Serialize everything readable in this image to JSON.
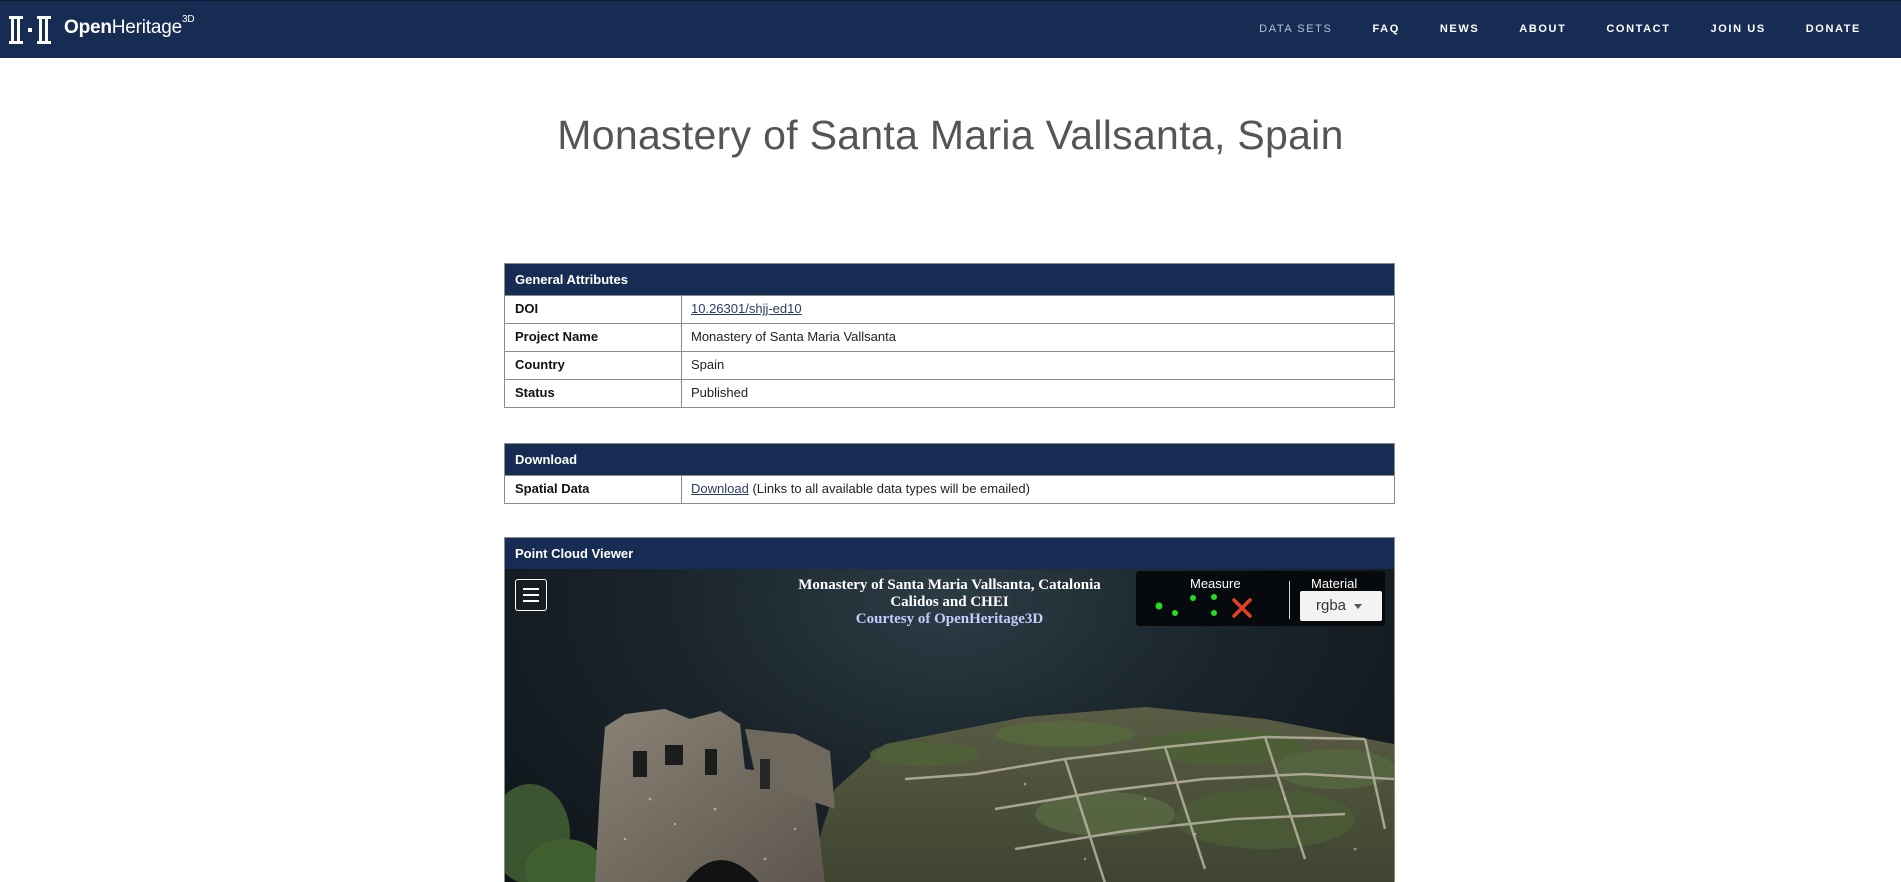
{
  "header": {
    "logo_text_bold": "Open",
    "logo_text_light": "Heritage",
    "logo_sup": "3D",
    "nav": [
      "DATA SETS",
      "FAQ",
      "NEWS",
      "ABOUT",
      "CONTACT",
      "JOIN US",
      "DONATE"
    ],
    "active_nav": "DATA SETS",
    "bg_color": "#172c53"
  },
  "page_title": "Monastery of Santa Maria Vallsanta, Spain",
  "general_attributes": {
    "heading": "General Attributes",
    "rows": [
      {
        "key": "DOI",
        "value": "10.26301/shjj-ed10",
        "link": true
      },
      {
        "key": "Project Name",
        "value": "Monastery of Santa Maria Vallsanta",
        "link": false
      },
      {
        "key": "Country",
        "value": "Spain",
        "link": false
      },
      {
        "key": "Status",
        "value": "Published",
        "link": false
      }
    ]
  },
  "download": {
    "heading": "Download",
    "row_key": "Spatial Data",
    "link_text": "Download",
    "note": " (Links to all available data types will be emailed)"
  },
  "viewer": {
    "heading": "Point Cloud Viewer",
    "title_line1": "Monastery of Santa Maria Vallsanta, Catalonia",
    "title_line2": "Calidos and CHEI",
    "title_line3": "Courtesy of OpenHeritage3D",
    "measure_label": "Measure",
    "material_label": "Material",
    "material_value": "rgba",
    "icons": [
      "menu-icon",
      "point-measure-icon",
      "distance-measure-icon",
      "area-measure-icon",
      "clear-measurements-icon"
    ],
    "accent_green": "#22dd22",
    "accent_red": "#e2401f"
  }
}
